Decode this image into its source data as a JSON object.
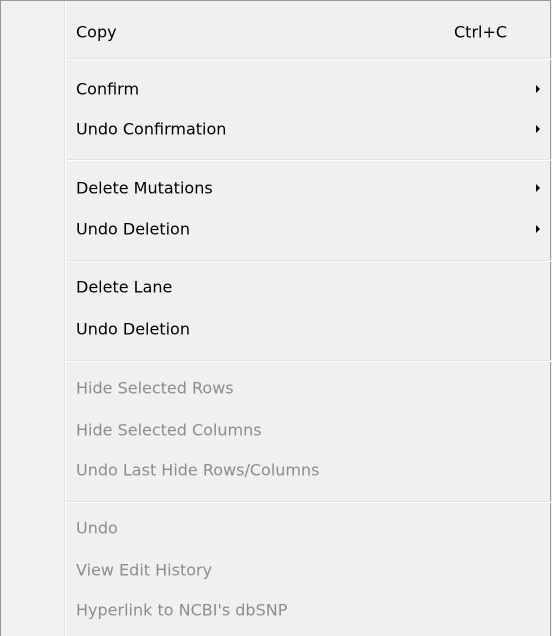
{
  "menu": {
    "copy": {
      "label": "Copy",
      "shortcut": "Ctrl+C"
    },
    "confirm": {
      "label": "Confirm"
    },
    "undo_confirmation": {
      "label": "Undo Confirmation"
    },
    "delete_mutations": {
      "label": "Delete Mutations"
    },
    "undo_deletion_sub": {
      "label": "Undo Deletion"
    },
    "delete_lane": {
      "label": "Delete Lane"
    },
    "undo_deletion": {
      "label": "Undo Deletion"
    },
    "hide_selected_rows": {
      "label": "Hide Selected Rows"
    },
    "hide_selected_columns": {
      "label": "Hide Selected Columns"
    },
    "undo_last_hide": {
      "label": "Undo Last Hide Rows/Columns"
    },
    "undo": {
      "label": "Undo"
    },
    "view_edit_history": {
      "label": "View Edit History"
    },
    "hyperlink_ncbi": {
      "label": "Hyperlink to NCBI's dbSNP"
    }
  },
  "colors": {
    "menu_background": "#f0f0f0",
    "enabled_text": "#000000",
    "disabled_text": "#8d8d8d",
    "separator": "#e0e0e0"
  },
  "icons": {
    "submenu_arrow": "submenu-arrow-icon"
  }
}
